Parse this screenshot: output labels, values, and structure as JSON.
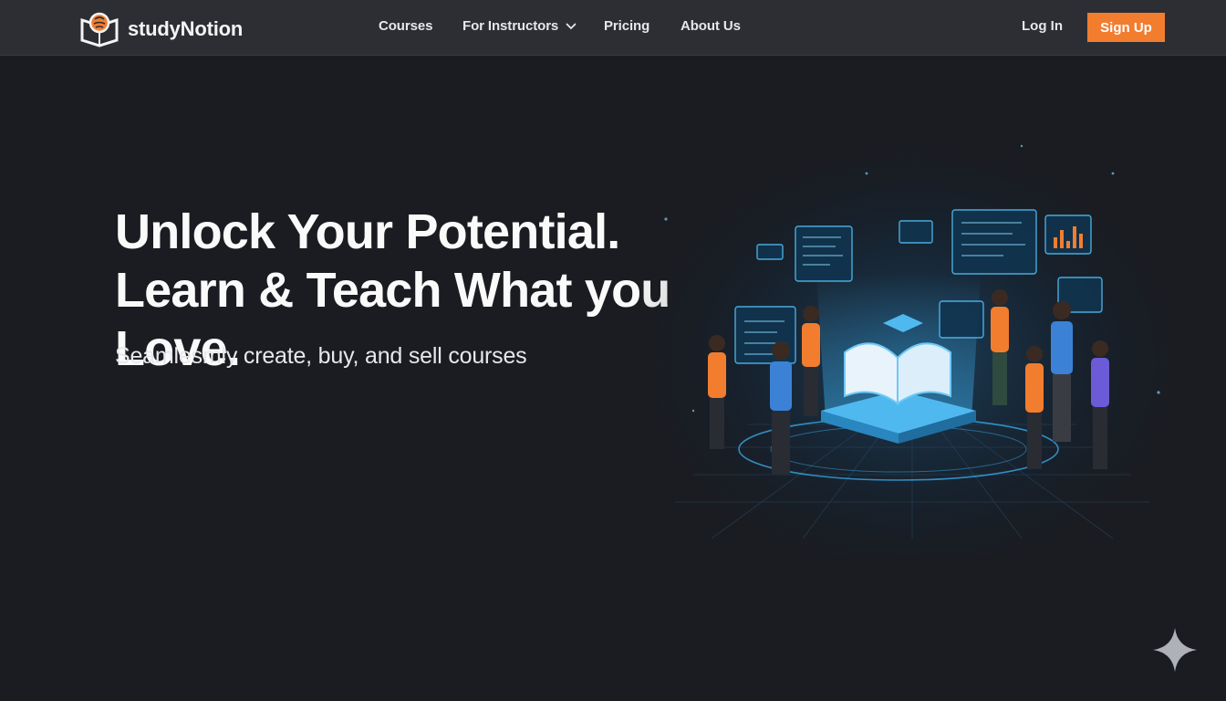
{
  "brand": {
    "name": "studyNotion",
    "icon": "book-brain-logo"
  },
  "nav": {
    "links": [
      {
        "label": "Courses"
      },
      {
        "label": "For Instructors",
        "icon": "chevron-down-icon"
      },
      {
        "label": "Pricing"
      },
      {
        "label": "About Us"
      }
    ]
  },
  "auth": {
    "login_label": "Log In",
    "signup_label": "Sign Up"
  },
  "hero": {
    "title_line1": "Unlock Your Potential.",
    "title_line2": "Learn & Teach What you Love.",
    "subtitle": "Seamlesmly create, buy, and sell courses"
  },
  "illustration": {
    "icon": "learning-community-illustration"
  },
  "fab": {
    "icon": "sparkle-icon"
  },
  "colors": {
    "background": "#1a1c21",
    "navbar": "#2c2e33",
    "accent": "#f27d2f",
    "glow": "#3aa8e6"
  }
}
